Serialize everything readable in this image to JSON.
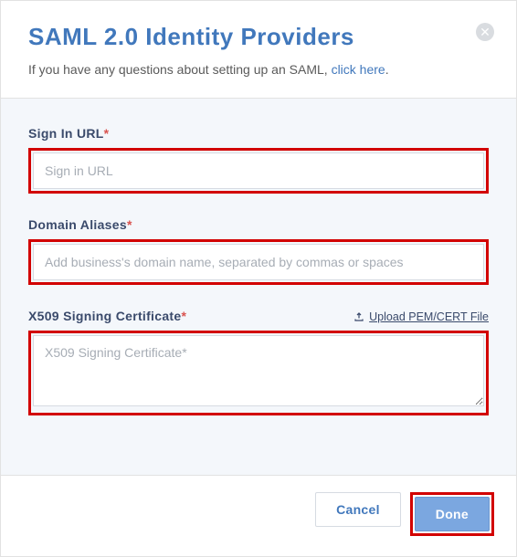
{
  "header": {
    "title": "SAML 2.0 Identity Providers",
    "subtitle_pre": "If you have any questions about setting up an SAML, ",
    "subtitle_link": "click here",
    "subtitle_post": "."
  },
  "form": {
    "sign_in_url": {
      "label": "Sign In URL",
      "placeholder": "Sign in URL",
      "value": ""
    },
    "domain_aliases": {
      "label": "Domain Aliases",
      "placeholder": "Add business's domain name, separated by commas or spaces",
      "value": ""
    },
    "x509": {
      "label": "X509 Signing Certificate",
      "placeholder": "X509 Signing Certificate*",
      "value": "",
      "upload_label": "Upload PEM/CERT File"
    }
  },
  "footer": {
    "cancel": "Cancel",
    "done": "Done"
  }
}
